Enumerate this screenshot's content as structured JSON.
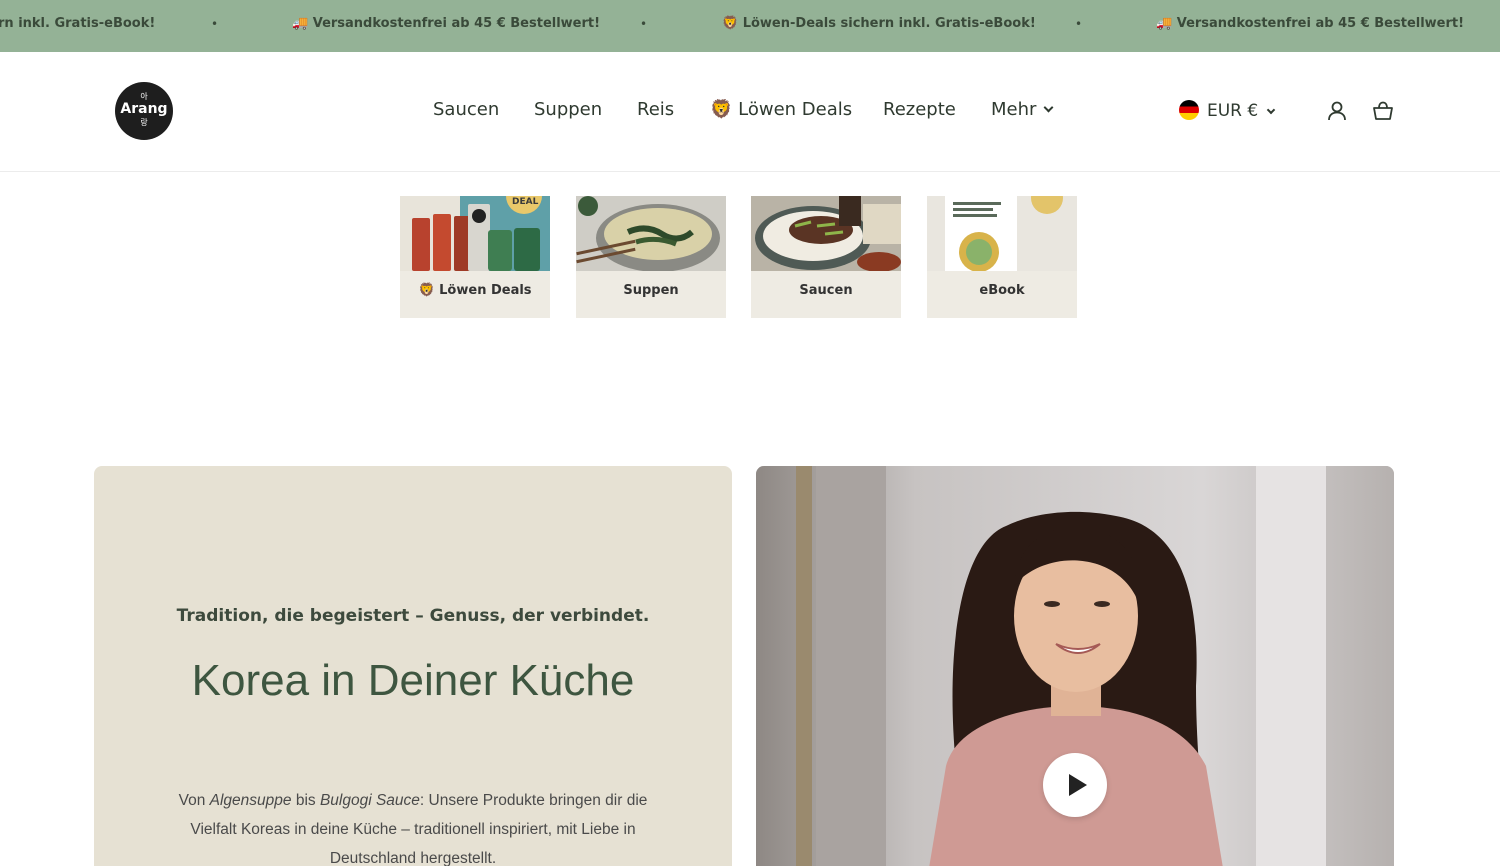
{
  "announcement": {
    "items": [
      "rn inkl. Gratis-eBook!",
      "🚚 Versandkostenfrei ab 45 € Bestellwert!",
      "🦁 Löwen-Deals sichern inkl. Gratis-eBook!",
      "🚚 Versandkostenfrei ab 45 € Bestellwert!"
    ],
    "separator": "•"
  },
  "header": {
    "logo": {
      "top": "아",
      "main": "Arang",
      "bottom": "랑"
    },
    "nav": [
      "Saucen",
      "Suppen",
      "Reis",
      "🦁 Löwen Deals",
      "Rezepte",
      "Mehr"
    ],
    "currency": "EUR €",
    "icons": [
      "account-icon",
      "cart-icon"
    ]
  },
  "categories": [
    {
      "label": "🦁 Löwen Deals",
      "badge": "DEAL"
    },
    {
      "label": "Suppen"
    },
    {
      "label": "Saucen"
    },
    {
      "label": "eBook"
    }
  ],
  "hero": {
    "kicker": "Tradition, die begeistert – Genuss, der verbindet.",
    "title": "Korea in Deiner Küche",
    "body": {
      "pre": "Von ",
      "italic1": "Algensuppe",
      "mid": " bis ",
      "italic2": "Bulgogi Sauce",
      "post": ": Unsere Produkte bringen dir die Vielfalt Koreas in deine Küche – traditionell inspiriert, mit Liebe in Deutschland hergestellt."
    }
  },
  "colors": {
    "announcement_bg": "#94b296",
    "hero_panel_bg": "#e6e1d3",
    "tile_bg": "#eeebe3",
    "accent_green": "#3e5640"
  }
}
